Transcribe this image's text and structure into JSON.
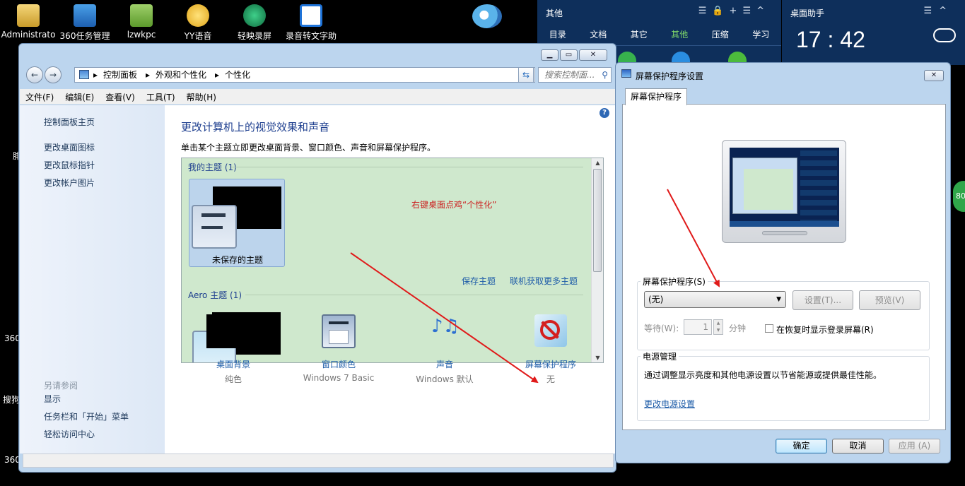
{
  "desktop": {
    "icons": [
      {
        "label": "Administrato"
      },
      {
        "label": "360任务管理"
      },
      {
        "label": "lzwkpc"
      },
      {
        "label": "YY语音"
      },
      {
        "label": "轻映录屏"
      },
      {
        "label": "录音转文字助"
      }
    ],
    "edge_labels": [
      "腓",
      "360",
      "搜狗",
      "360"
    ],
    "right_badge": "80"
  },
  "panel360": {
    "title": "其他",
    "tabs": [
      "目录",
      "文档",
      "其它",
      "其他",
      "压缩",
      "学习"
    ],
    "active_tab": "其他",
    "accent": "#7fd86a"
  },
  "helper": {
    "title": "桌面助手",
    "time": "17 : 42"
  },
  "explorer": {
    "breadcrumbs": [
      "控制面板",
      "外观和个性化",
      "个性化"
    ],
    "search_placeholder": "搜索控制面...",
    "menu": [
      "文件(F)",
      "编辑(E)",
      "查看(V)",
      "工具(T)",
      "帮助(H)"
    ],
    "left_links": [
      "控制面板主页",
      "更改桌面图标",
      "更改鼠标指针",
      "更改帐户图片"
    ],
    "see_also_header": "另请参阅",
    "see_also": [
      "显示",
      "任务栏和「开始」菜单",
      "轻松访问中心"
    ],
    "main_title": "更改计算机上的视觉效果和声音",
    "main_desc": "单击某个主题立即更改桌面背景、窗口颜色、声音和屏幕保护程序。",
    "my_themes": "我的主题 (1)",
    "unsaved_theme": "未保存的主题",
    "annotation": "右键桌面点鸡“个性化”",
    "save_theme": "保存主题",
    "more_themes": "联机获取更多主题",
    "aero_themes": "Aero 主题 (1)",
    "bottom_items": [
      {
        "label": "桌面背景",
        "sub": "纯色"
      },
      {
        "label": "窗口颜色",
        "sub": "Windows 7 Basic"
      },
      {
        "label": "声音",
        "sub": "Windows 默认"
      },
      {
        "label": "屏幕保护程序",
        "sub": "无"
      }
    ]
  },
  "dialog": {
    "title": "屏幕保护程序设置",
    "tab": "屏幕保护程序",
    "group_saver": "屏幕保护程序(S)",
    "saver_value": "(无)",
    "settings_btn": "设置(T)...",
    "preview_btn": "预览(V)",
    "wait_label": "等待(W):",
    "wait_value": "1",
    "minutes": "分钟",
    "resume_label": "在恢复时显示登录屏幕(R)",
    "group_power": "电源管理",
    "power_desc": "通过调整显示亮度和其他电源设置以节省能源或提供最佳性能。",
    "power_link": "更改电源设置",
    "ok": "确定",
    "cancel": "取消",
    "apply": "应用 (A)"
  },
  "colors": {
    "annotation_arrow": "#e01a1a",
    "link": "#1e5ca8",
    "title_blue": "#1e3f8f"
  }
}
